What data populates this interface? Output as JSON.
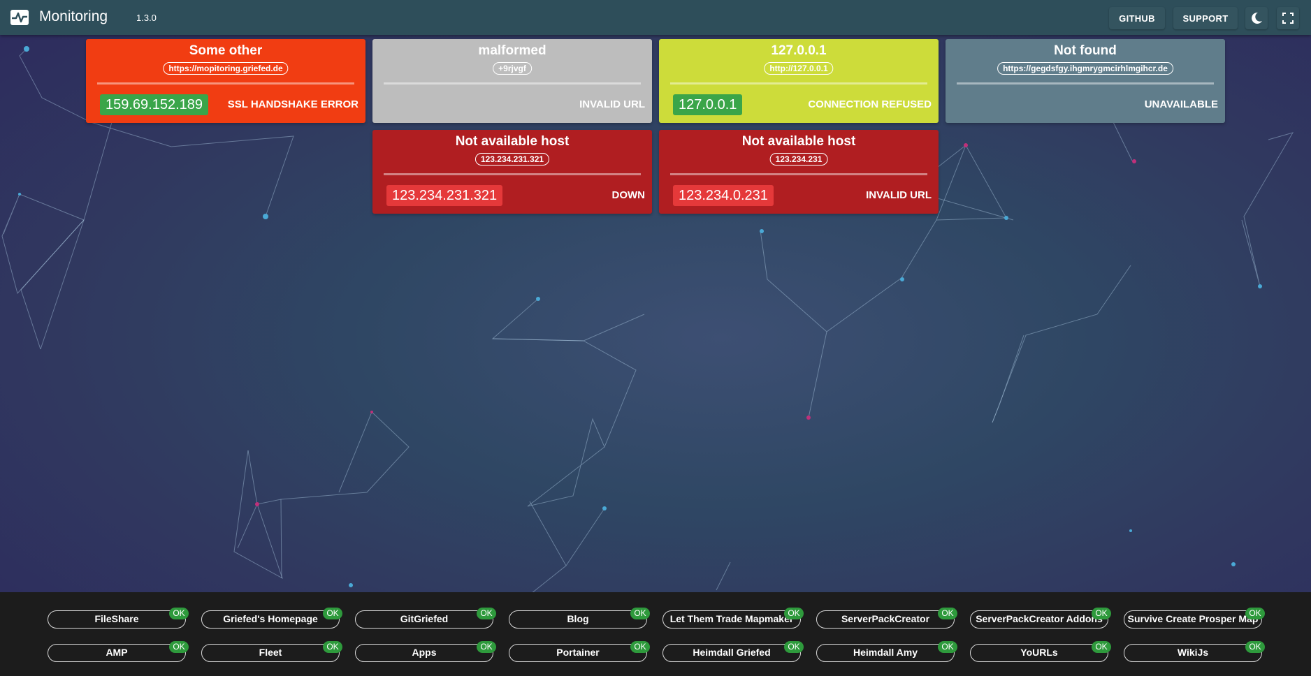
{
  "header": {
    "title": "Monitoring",
    "version": "1.3.0",
    "github_label": "GITHUB",
    "support_label": "SUPPORT",
    "theme_icon": "moon-icon",
    "fullscreen_icon": "fullscreen-icon",
    "logo_icon": "heartbeat-icon"
  },
  "cards": [
    {
      "title": "Some other",
      "url": "https://mopitoring.griefed.de",
      "ip": "159.69.152.189",
      "status": "SSL HANDSHAKE ERROR",
      "color": "#f13d12",
      "ip_color": "#3aa549"
    },
    {
      "title": "malformed",
      "url": "+9rjvgf",
      "ip": "",
      "status": "INVALID URL",
      "color": "#bdbdbd",
      "ip_color": ""
    },
    {
      "title": "127.0.0.1",
      "url": "http://127.0.0.1",
      "ip": "127.0.0.1",
      "status": "CONNECTION REFUSED",
      "color": "#cddc3a",
      "ip_color": "#3aa549"
    },
    {
      "title": "Not found",
      "url": "https://gegdsfgy.ihgmrygmcirhlmgihcr.de",
      "ip": "",
      "status": "UNAVAILABLE",
      "color": "#607d8b",
      "ip_color": ""
    },
    {
      "title": "Not available host",
      "url": "123.234.231.321",
      "ip": "123.234.231.321",
      "status": "DOWN",
      "color": "#b01e21",
      "ip_color": "#e5393a"
    },
    {
      "title": "Not available host",
      "url": "123.234.231",
      "ip": "123.234.0.231",
      "status": "INVALID URL",
      "color": "#b01e21",
      "ip_color": "#e5393a"
    }
  ],
  "services": [
    {
      "name": "FileShare",
      "status": "OK"
    },
    {
      "name": "Griefed's Homepage",
      "status": "OK"
    },
    {
      "name": "GitGriefed",
      "status": "OK"
    },
    {
      "name": "Blog",
      "status": "OK"
    },
    {
      "name": "Let Them Trade Mapmaker",
      "status": "OK"
    },
    {
      "name": "ServerPackCreator",
      "status": "OK"
    },
    {
      "name": "ServerPackCreator Addons",
      "status": "OK"
    },
    {
      "name": "Survive Create Prosper Map",
      "status": "OK"
    },
    {
      "name": "AMP",
      "status": "OK"
    },
    {
      "name": "Fleet",
      "status": "OK"
    },
    {
      "name": "Apps",
      "status": "OK"
    },
    {
      "name": "Portainer",
      "status": "OK"
    },
    {
      "name": "Heimdall Griefed",
      "status": "OK"
    },
    {
      "name": "Heimdall Amy",
      "status": "OK"
    },
    {
      "name": "YoURLs",
      "status": "OK"
    },
    {
      "name": "WikiJs",
      "status": "OK"
    }
  ],
  "colors": {
    "header_bg": "#2e4e5a",
    "bottom_bg": "#1c1c1c",
    "ok_badge": "#2e9a3c"
  }
}
